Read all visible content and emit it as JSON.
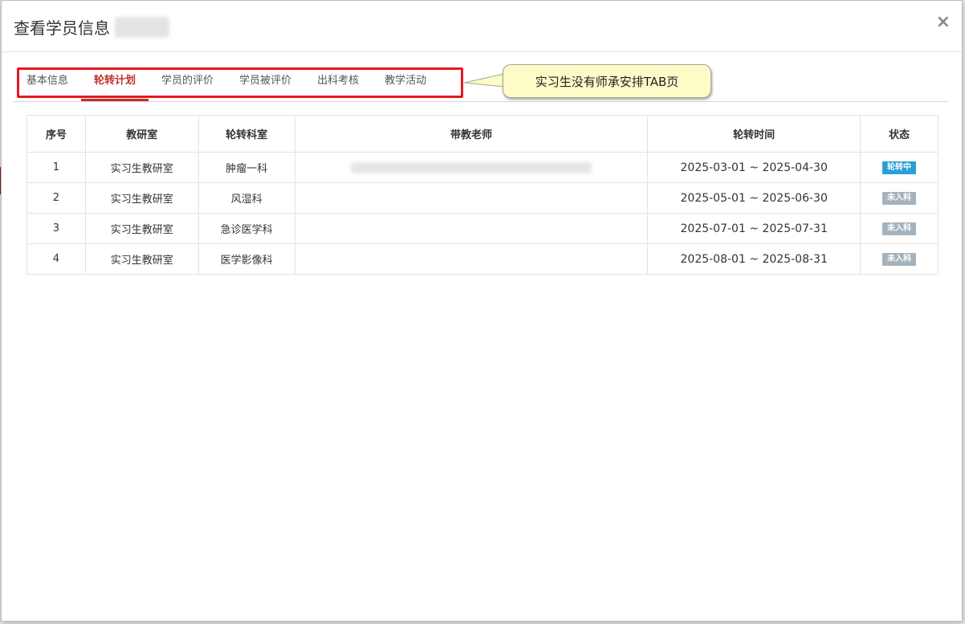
{
  "modal": {
    "title": "查看学员信息",
    "close_label": "×"
  },
  "tabs": [
    {
      "label": "基本信息",
      "active": false
    },
    {
      "label": "轮转计划",
      "active": true
    },
    {
      "label": "学员的评价",
      "active": false
    },
    {
      "label": "学员被评价",
      "active": false
    },
    {
      "label": "出科考核",
      "active": false
    },
    {
      "label": "教学活动",
      "active": false
    }
  ],
  "callout": {
    "text": "实习生没有师承安排TAB页"
  },
  "table": {
    "headers": [
      "序号",
      "教研室",
      "轮转科室",
      "带教老师",
      "轮转时间",
      "状态"
    ],
    "rows": [
      {
        "no": "1",
        "dept": "实习生教研室",
        "ward": "肿瘤一科",
        "teacher_blurred": true,
        "time": "2025-03-01 ~ 2025-04-30",
        "status": "轮转中",
        "status_type": "active"
      },
      {
        "no": "2",
        "dept": "实习生教研室",
        "ward": "风湿科",
        "teacher_blurred": false,
        "time": "2025-05-01 ~ 2025-06-30",
        "status": "未入科",
        "status_type": "pending"
      },
      {
        "no": "3",
        "dept": "实习生教研室",
        "ward": "急诊医学科",
        "teacher_blurred": false,
        "time": "2025-07-01 ~ 2025-07-31",
        "status": "未入科",
        "status_type": "pending"
      },
      {
        "no": "4",
        "dept": "实习生教研室",
        "ward": "医学影像科",
        "teacher_blurred": false,
        "time": "2025-08-01 ~ 2025-08-31",
        "status": "未入科",
        "status_type": "pending"
      }
    ]
  },
  "colors": {
    "accent": "#c0302a",
    "highlight_box": "#e5181e",
    "badge_active": "#2a9fd6",
    "badge_pending": "#a5b2bb",
    "callout_bg": "#fdfbc8"
  }
}
